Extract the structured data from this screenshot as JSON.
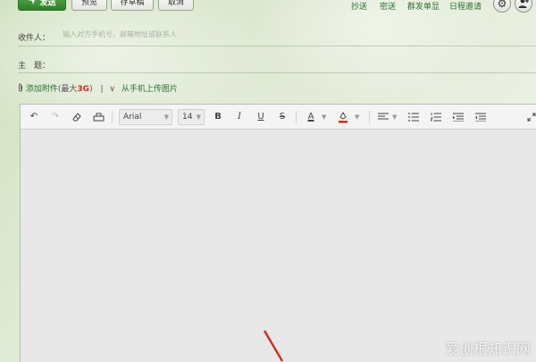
{
  "toolbar": {
    "send": "发送",
    "preview": "预览",
    "save_draft": "存草稿",
    "cancel": "取消",
    "links": [
      "抄送",
      "密送",
      "群发单显",
      "日程邀请"
    ],
    "settings_icon": "gear-icon",
    "contacts_icon": "add-contact-icon"
  },
  "form": {
    "recipient_label": "收件人：",
    "recipient_placeholder": "输入对方手机号、邮箱地址或联系人",
    "subject_label": "主　题：",
    "attachment_label": "添加附件",
    "attachment_limit_prefix": "(最大",
    "attachment_limit_value": "3G",
    "attachment_limit_suffix": ")",
    "upload_from_phone": "从手机上传图片"
  },
  "editor": {
    "font_family": "Arial",
    "font_size": "14",
    "bold": "B",
    "italic": "I",
    "underline": "U",
    "strike": "S",
    "font_color": "A",
    "accent_color": "#d02b1f"
  },
  "watermark": "爱创根知识网"
}
